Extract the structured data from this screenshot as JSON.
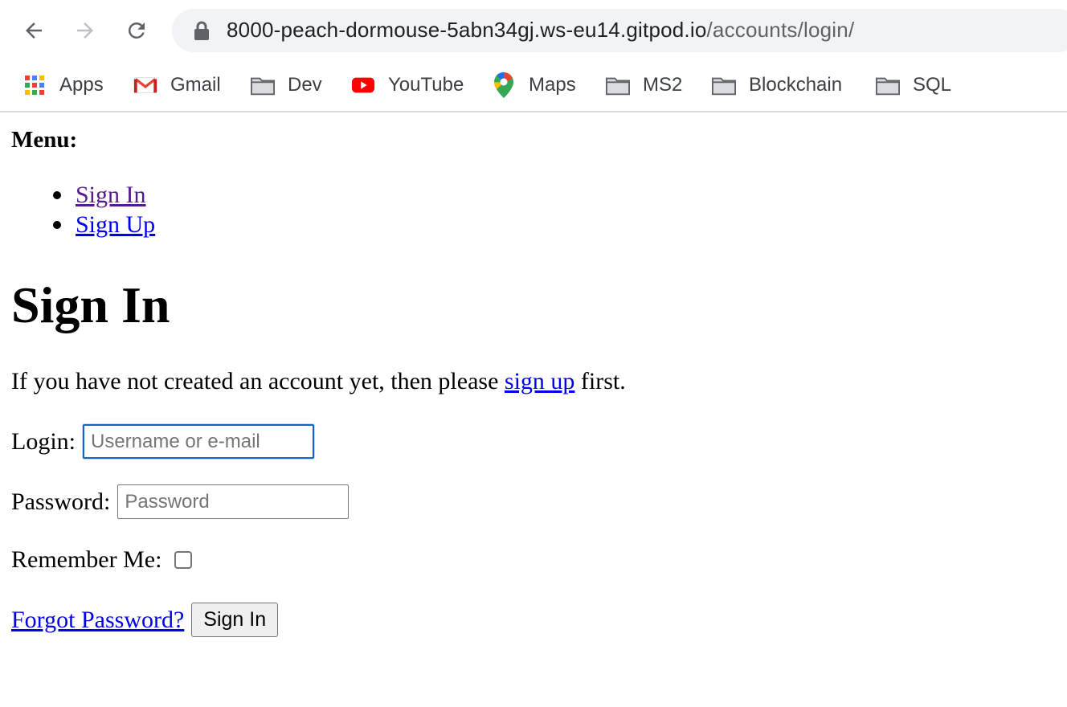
{
  "browser": {
    "url_host": "8000-peach-dormouse-5abn34gj.ws-eu14.gitpod.io",
    "url_path": "/accounts/login/",
    "bookmarks": [
      {
        "label": "Apps",
        "icon": "apps-grid-icon"
      },
      {
        "label": "Gmail",
        "icon": "gmail-icon"
      },
      {
        "label": "Dev",
        "icon": "folder-icon"
      },
      {
        "label": "YouTube",
        "icon": "youtube-icon"
      },
      {
        "label": "Maps",
        "icon": "maps-pin-icon"
      },
      {
        "label": "MS2",
        "icon": "folder-icon"
      },
      {
        "label": "Blockchain",
        "icon": "folder-icon"
      },
      {
        "label": "SQL",
        "icon": "folder-icon"
      }
    ]
  },
  "menu": {
    "title": "Menu:",
    "items": [
      {
        "label": "Sign In",
        "visited": true
      },
      {
        "label": "Sign Up",
        "visited": false
      }
    ]
  },
  "page": {
    "title": "Sign In",
    "intro_before": "If you have not created an account yet, then please ",
    "intro_link": "sign up",
    "intro_after": " first."
  },
  "form": {
    "login_label": "Login:",
    "login_placeholder": "Username or e-mail",
    "login_value": "",
    "password_label": "Password:",
    "password_placeholder": "Password",
    "password_value": "",
    "remember_label": "Remember Me:",
    "remember_checked": false,
    "forgot_link": "Forgot Password?",
    "submit_label": "Sign In"
  },
  "colors": {
    "link": "#0000ee",
    "visited_link": "#551a8b",
    "focus_border": "#1a63c6",
    "omnibox_bg": "#f1f3f4"
  }
}
